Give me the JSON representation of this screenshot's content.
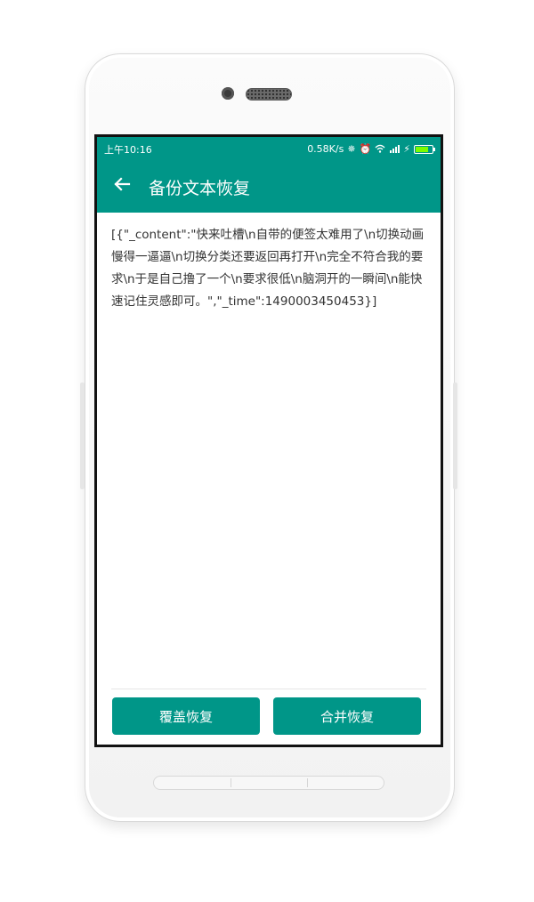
{
  "status_bar": {
    "time": "上午10:16",
    "network_speed": "0.58K/s",
    "icons": [
      "sync-icon",
      "alarm-icon",
      "wifi-icon",
      "signal-icon",
      "charging-icon",
      "battery-icon"
    ],
    "battery_level": 0.8
  },
  "app_bar": {
    "back_icon": "arrow-left-icon",
    "title": "备份文本恢复"
  },
  "content": {
    "backup_text": "[{\"_content\":\"快来吐槽\\n自带的便签太难用了\\n切换动画慢得一逼逼\\n切换分类还要返回再打开\\n完全不符合我的要求\\n于是自己撸了一个\\n要求很低\\n脑洞开的一瞬间\\n能快速记住灵感即可。\",\"_time\":1490003450453}]"
  },
  "actions": {
    "overwrite_label": "覆盖恢复",
    "merge_label": "合并恢复"
  },
  "colors": {
    "primary": "#009688",
    "text": "#333333",
    "background": "#ffffff"
  }
}
